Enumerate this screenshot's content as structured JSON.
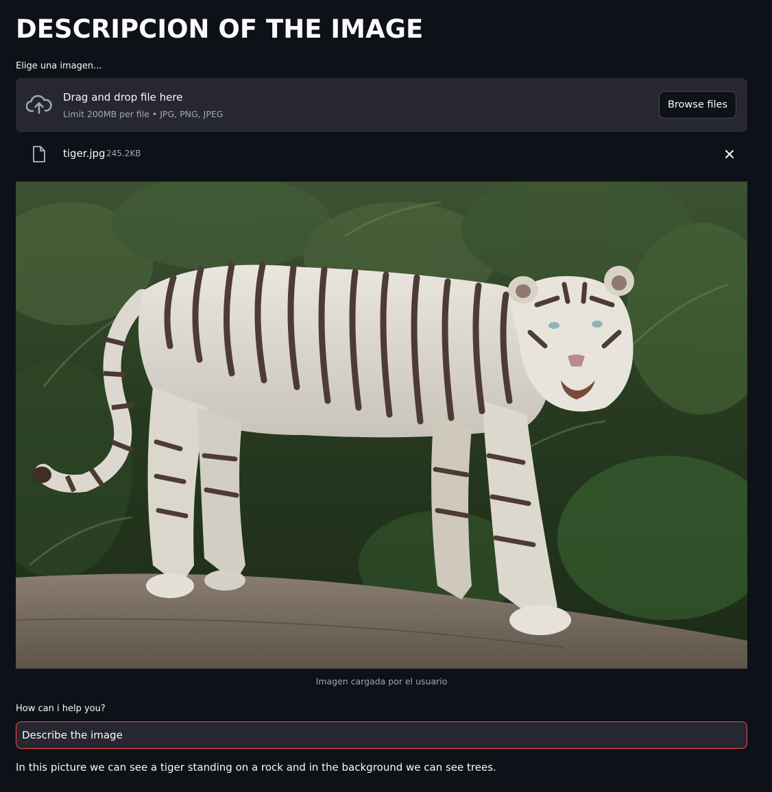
{
  "page": {
    "title": "DESCRIPCION OF THE IMAGE"
  },
  "uploader": {
    "label": "Elige una imagen...",
    "drop_title": "Drag and drop file here",
    "drop_subtitle": "Limit 200MB per file • JPG, PNG, JPEG",
    "browse_label": "Browse files",
    "icon": "cloud-upload-icon"
  },
  "uploaded_file": {
    "name": "tiger.jpg",
    "size": "245.2KB",
    "icon": "file-icon",
    "remove_icon": "close-icon"
  },
  "image": {
    "caption": "Imagen cargada por el usuario"
  },
  "prompt": {
    "label": "How can i help you?",
    "value": "Describe the image"
  },
  "response": {
    "text": "In this picture we can see a tiger standing on a rock and in the background we can see trees."
  },
  "colors": {
    "background": "#0e1117",
    "surface": "#262730",
    "text": "#fafafa",
    "muted": "#a3a8b8",
    "focus_border": "#ff4b4b"
  }
}
